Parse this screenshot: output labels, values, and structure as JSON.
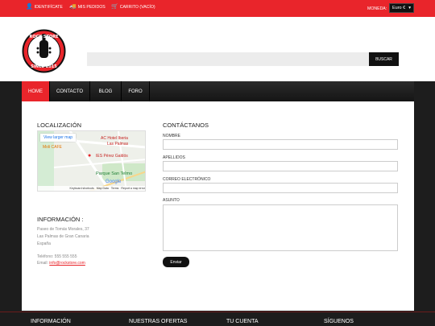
{
  "topbar": {
    "login_label": "Identifícate",
    "orders_label": "Mis pedidos",
    "cart_label": "Carrito (vacío)",
    "currency_label": "Moneda:",
    "currency_value": "Euro €"
  },
  "logo": {
    "line1": "ROCK STORE",
    "line2": "SINCE 2015"
  },
  "search": {
    "button_label": "Buscar",
    "value": ""
  },
  "nav": {
    "items": [
      {
        "label": "Home",
        "active": true
      },
      {
        "label": "Contacto",
        "active": false
      },
      {
        "label": "Blog",
        "active": false
      },
      {
        "label": "Foro",
        "active": false
      }
    ]
  },
  "location": {
    "heading": "Localización",
    "map": {
      "view_larger": "View larger map",
      "hotel": "AC Hotel Iberia",
      "city": "Las Palmas",
      "cafe": "Moli CAFE",
      "pin": "IES Pérez Galdós",
      "park": "Parque San Telmo",
      "google": "Google",
      "footer_shortcuts": "Keyboard shortcuts",
      "footer_mapdata": "Map Data",
      "footer_terms": "Terms",
      "footer_report": "Report a map error"
    }
  },
  "info": {
    "heading": "Información :",
    "address1": "Paseo de Tomás Morales, 37",
    "address2": "Las Palmas de Gran Canaria",
    "country": "España",
    "phone": "Teléfono: 555 555 555",
    "email_label": "Email:",
    "email": "info@rockstore.com"
  },
  "contact": {
    "heading": "Contáctanos",
    "name_label": "Nombre",
    "surname_label": "Apellidos",
    "email_label": "Correo electrónico",
    "subject_label": "Asunto",
    "send_label": "Enviar"
  },
  "footer": {
    "col1": "Información",
    "col2": "Nuestras ofertas",
    "col3": "Tu cuenta",
    "col4": "Síguenos"
  },
  "colors": {
    "accent": "#e9252b",
    "dark": "#111111"
  }
}
